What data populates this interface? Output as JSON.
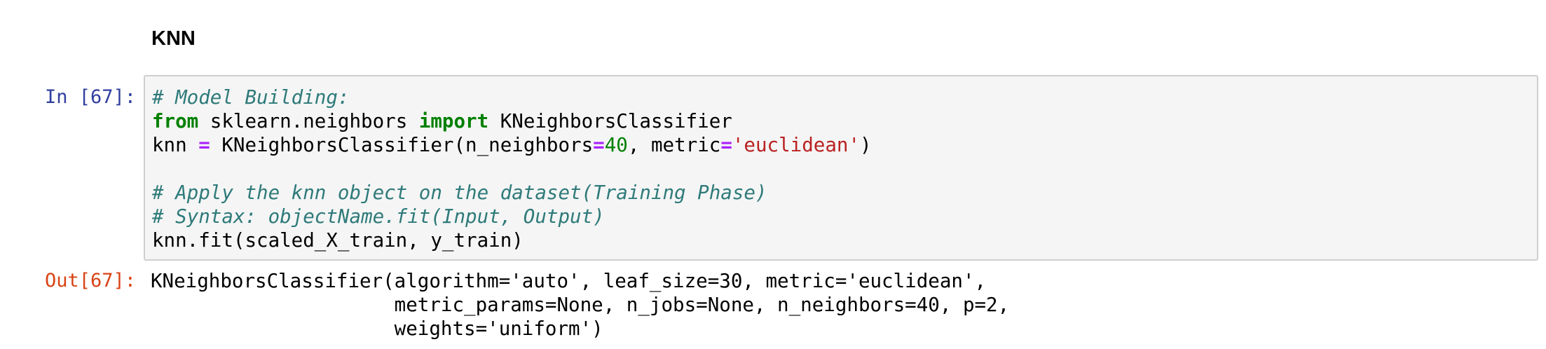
{
  "markdown_cell": {
    "heading": "KNN"
  },
  "code_cell": {
    "input_prompt": "In [67]:",
    "output_prompt": "Out[67]:",
    "lines": {
      "l1": {
        "comment": "# Model Building:"
      },
      "l2": {
        "kw1": "from",
        "t1": " sklearn.neighbors ",
        "kw2": "import",
        "t2": " KNeighborsClassifier"
      },
      "l3": {
        "t1": "knn ",
        "op1": "=",
        "t2": " KNeighborsClassifier(n_neighbors",
        "op2": "=",
        "num": "40",
        "t3": ", metric",
        "op3": "=",
        "str": "'euclidean'",
        "t4": ")"
      },
      "l5": {
        "comment": "# Apply the knn object on the dataset(Training Phase)"
      },
      "l6": {
        "comment": "# Syntax: objectName.fit(Input, Output)"
      },
      "l7": {
        "t1": "knn.fit(scaled_X_train, y_train)"
      }
    },
    "output_lines": [
      "KNeighborsClassifier(algorithm='auto', leaf_size=30, metric='euclidean',",
      "                     metric_params=None, n_jobs=None, n_neighbors=40, p=2,",
      "                     weights='uniform')"
    ]
  }
}
